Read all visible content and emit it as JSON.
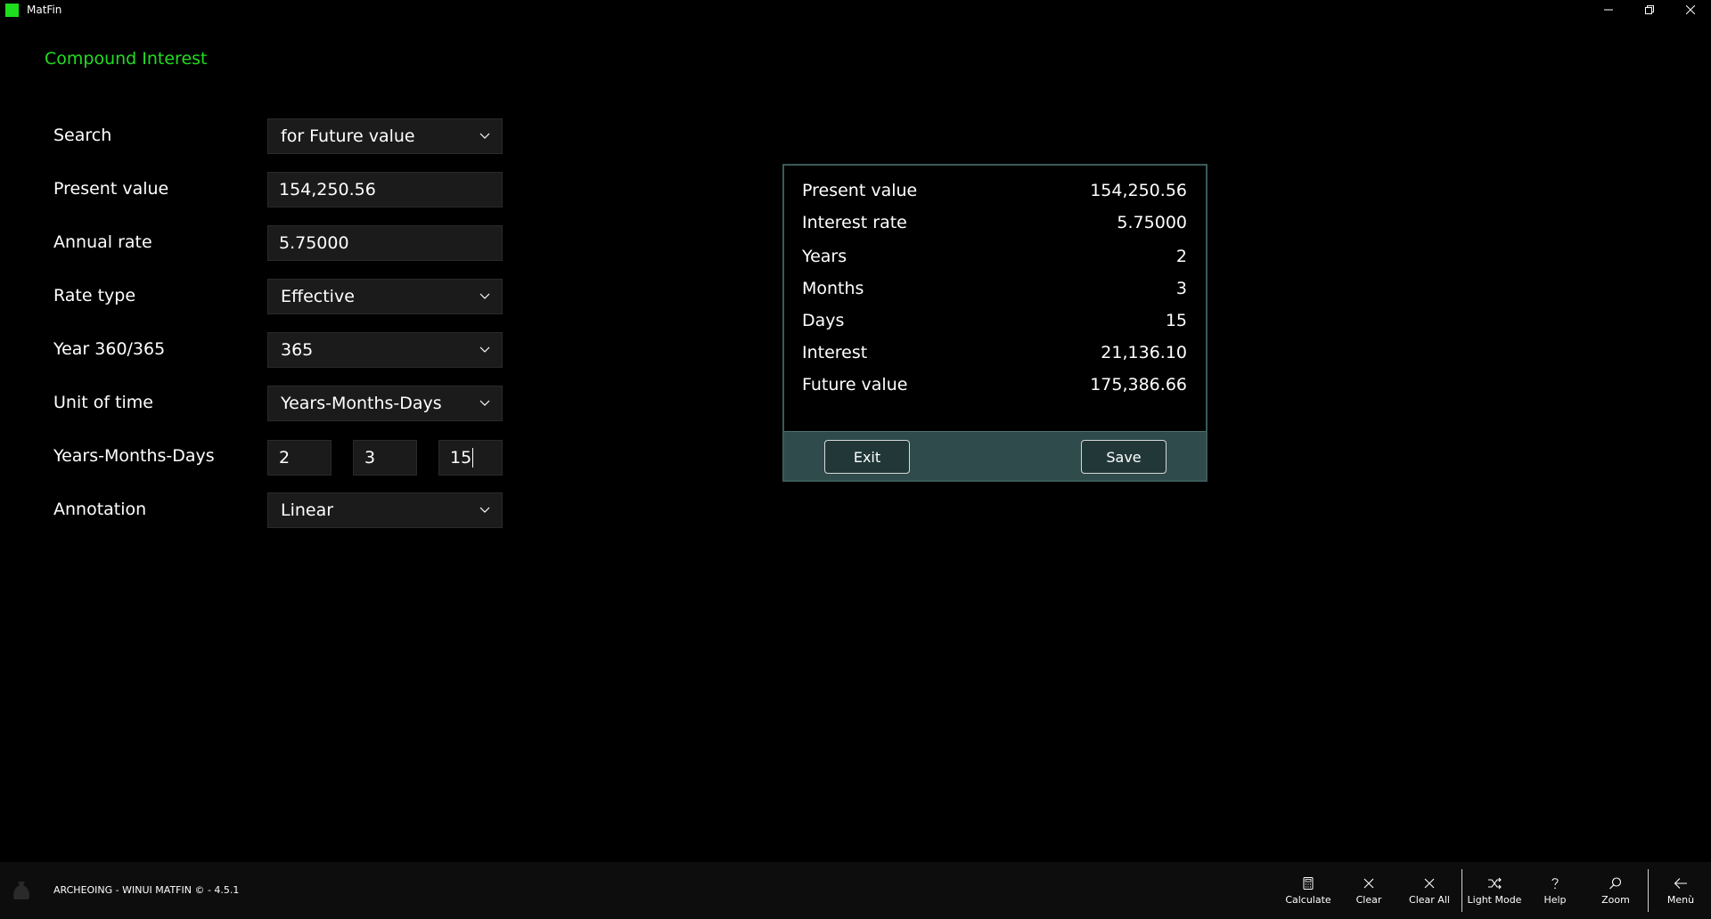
{
  "window": {
    "title": "MatFin",
    "controls": [
      "minimize",
      "restore",
      "close"
    ]
  },
  "page": {
    "title": "Compound Interest"
  },
  "form": {
    "search": {
      "label": "Search",
      "value": "for Future value"
    },
    "present_value": {
      "label": "Present value",
      "value": "154,250.56"
    },
    "annual_rate": {
      "label": "Annual rate",
      "value": "5.75000"
    },
    "rate_type": {
      "label": "Rate type",
      "value": "Effective"
    },
    "year_basis": {
      "label": "Year 360/365",
      "value": "365"
    },
    "unit_of_time": {
      "label": "Unit of time",
      "value": "Years-Months-Days"
    },
    "ymd": {
      "label": "Years-Months-Days",
      "years": "2",
      "months": "3",
      "days": "15"
    },
    "annotation": {
      "label": "Annotation",
      "value": "Linear"
    }
  },
  "result": {
    "rows": [
      {
        "label": "Present value",
        "value": "154,250.56"
      },
      {
        "label": "Interest rate",
        "value": "5.75000"
      },
      {
        "label": "Years",
        "value": "2"
      },
      {
        "label": "Months",
        "value": "3"
      },
      {
        "label": "Days",
        "value": "15"
      },
      {
        "label": "Interest",
        "value": "21,136.10"
      },
      {
        "label": "Future value",
        "value": "175,386.66"
      }
    ],
    "exit_label": "Exit",
    "save_label": "Save"
  },
  "footer": {
    "text": "ARCHEOING - WINUI MATFIN © - 4.5.1",
    "commands": [
      {
        "label": "Calculate",
        "icon": "calculator-icon"
      },
      {
        "label": "Clear",
        "icon": "close-icon"
      },
      {
        "label": "Clear All",
        "icon": "close-icon"
      },
      {
        "label": "Light Mode",
        "icon": "shuffle-icon"
      },
      {
        "label": "Help",
        "icon": "question-icon"
      },
      {
        "label": "Zoom",
        "icon": "search-icon"
      },
      {
        "label": "Menù",
        "icon": "back-arrow-icon"
      }
    ]
  },
  "colors": {
    "accent": "#22dd22",
    "background": "#000000",
    "field_bg": "#1b1b1b",
    "dialog_footer": "#2f4b4b",
    "dialog_border": "#3b5a5a"
  }
}
